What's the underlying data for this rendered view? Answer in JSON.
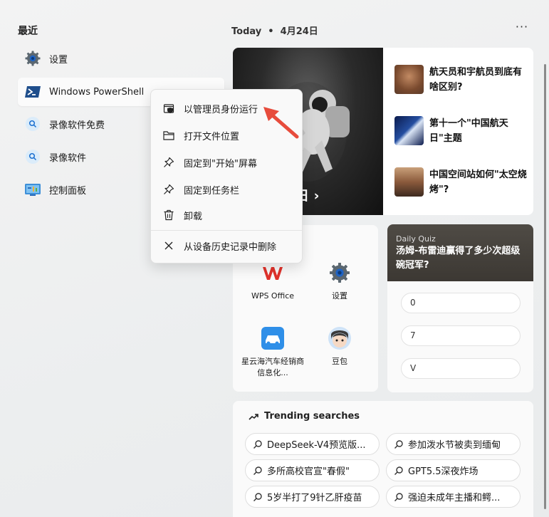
{
  "recent": {
    "title": "最近",
    "items": [
      {
        "label": "设置",
        "icon": "gear-icon"
      },
      {
        "label": "Windows PowerShell",
        "icon": "powershell-icon"
      },
      {
        "label": "录像软件免费",
        "icon": "search-icon"
      },
      {
        "label": "录像软件",
        "icon": "search-icon"
      },
      {
        "label": "控制面板",
        "icon": "control-panel-icon"
      }
    ]
  },
  "context_menu": {
    "items": [
      {
        "label": "以管理员身份运行",
        "icon": "shield-icon"
      },
      {
        "label": "打开文件位置",
        "icon": "folder-icon"
      },
      {
        "label": "固定到\"开始\"屏幕",
        "icon": "pin-icon"
      },
      {
        "label": "固定到任务栏",
        "icon": "pin-icon"
      },
      {
        "label": "卸载",
        "icon": "trash-icon"
      },
      {
        "label": "从设备历史记录中删除",
        "icon": "close-icon"
      }
    ]
  },
  "header": {
    "today": "Today",
    "date": "4月24日",
    "more": "···"
  },
  "hero": {
    "text": "日 ›"
  },
  "news": [
    {
      "text": "航天员和宇航员到底有啥区别?"
    },
    {
      "text": "第十一个\"中国航天日\"主题"
    },
    {
      "text": "中国空间站如何\"太空烧烤\"?"
    }
  ],
  "apps": [
    {
      "label": "WPS Office",
      "icon": "wps-icon"
    },
    {
      "label": "设置",
      "icon": "gear-icon"
    },
    {
      "label": "星云海汽车经销商信息化...",
      "icon": "car-app-icon"
    },
    {
      "label": "豆包",
      "icon": "doubao-avatar-icon"
    }
  ],
  "quiz": {
    "tag": "Daily Quiz",
    "question": "汤姆-布雷迪赢得了多少次超级碗冠军?",
    "options": [
      "0",
      "7",
      "V"
    ]
  },
  "trending": {
    "title": "Trending searches",
    "items": [
      "DeepSeek-V4预览版...",
      "参加泼水节被卖到缅甸",
      "多所高校官宣\"春假\"",
      "GPT5.5深夜炸场",
      "5岁半打了9针乙肝疫苗",
      "强迫未成年主播和鳄..."
    ]
  },
  "colors": {
    "accent": "#e74c3c",
    "powershell": "#1f4e8c",
    "search_badge": "#dbecfa"
  }
}
